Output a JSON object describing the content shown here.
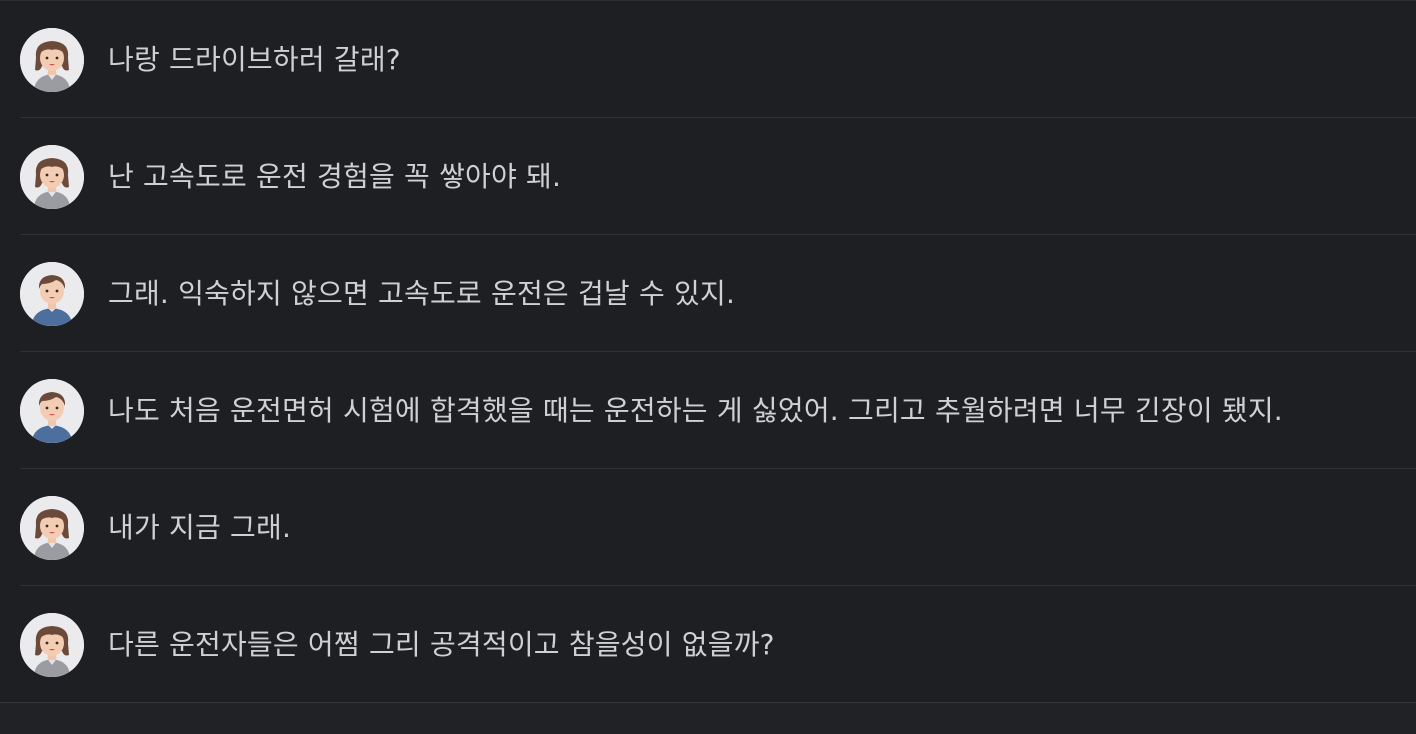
{
  "conversation": {
    "messages": [
      {
        "speaker": "female",
        "text": "나랑 드라이브하러 갈래?"
      },
      {
        "speaker": "female",
        "text": "난 고속도로 운전 경험을 꼭 쌓아야 돼."
      },
      {
        "speaker": "male",
        "text": "그래. 익숙하지 않으면 고속도로 운전은 겁날 수 있지."
      },
      {
        "speaker": "male",
        "text": "나도 처음 운전면허 시험에 합격했을 때는 운전하는 게 싫었어. 그리고 추월하려면 너무 긴장이 됐지."
      },
      {
        "speaker": "female",
        "text": "내가 지금 그래."
      },
      {
        "speaker": "female",
        "text": "다른 운전자들은 어쩜 그리 공격적이고 참을성이 없을까?"
      }
    ]
  },
  "icons": {
    "female": "female-avatar-icon",
    "male": "male-avatar-icon"
  },
  "colors": {
    "background": "#1e1f23",
    "text": "#cfd0d3",
    "divider": "#2e3035"
  }
}
